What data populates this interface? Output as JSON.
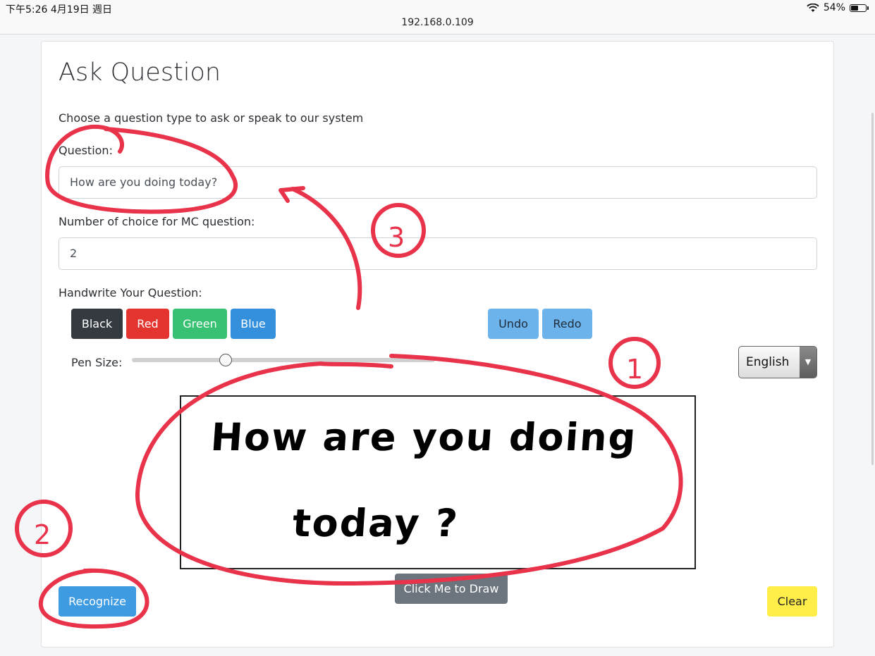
{
  "status_bar": {
    "time_date": "下午5:26   4月19日 週日",
    "battery_percent": "54%",
    "battery_level": 0.54,
    "url": "192.168.0.109"
  },
  "form": {
    "title": "Ask Question",
    "subtitle": "Choose a question type to ask or speak to our system",
    "question_label": "Question:",
    "question_value": "How are you doing today?",
    "choices_label": "Number of choice for MC question:",
    "choices_value": "2",
    "handwrite_label": "Handwrite Your Question:"
  },
  "pen_colors": [
    "Black",
    "Red",
    "Green",
    "Blue"
  ],
  "history_buttons": {
    "undo": "Undo",
    "redo": "Redo"
  },
  "pen_size": {
    "label": "Pen Size:",
    "level": 0.31
  },
  "language": {
    "selected": "English"
  },
  "canvas": {
    "handwriting_line1": "How are you doing",
    "handwriting_line2": "today ?",
    "draw_button": "Click Me to Draw"
  },
  "actions": {
    "recognize": "Recognize",
    "clear": "Clear"
  },
  "annotations": {
    "mark1": "1",
    "mark2": "2",
    "mark3": "3",
    "ink_color": "#e8334a"
  }
}
